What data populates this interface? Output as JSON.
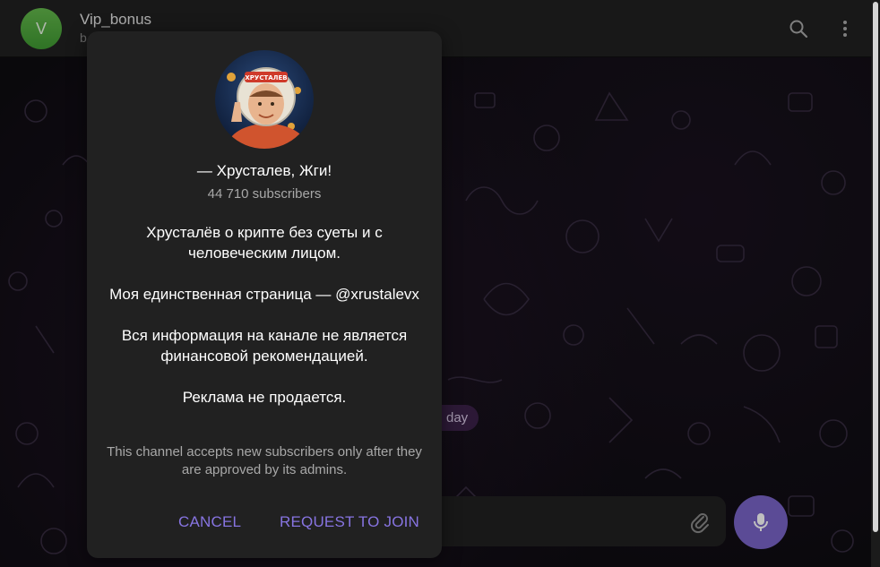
{
  "header": {
    "avatar_letter": "V",
    "avatar_color": "#55a940",
    "title": "Vip_bonus",
    "subtitle": "b"
  },
  "chat": {
    "date_pill": "day"
  },
  "dialog": {
    "channel_name": "— Хрусталев, Жги!",
    "subscribers": "44 710 subscribers",
    "description": [
      "Хрусталёв о крипте без суеты и с человеческим лицом.",
      "Моя единственная страница — @xrustalevx",
      "Вся информация на канале не является финансовой рекомендацией.",
      "Реклама не продается."
    ],
    "note": "This channel accepts new subscribers only after they are approved by its admins.",
    "cancel_label": "CANCEL",
    "join_label": "REQUEST TO JOIN",
    "photo_badge_text": "ХРУСТАЛЕВ"
  },
  "colors": {
    "accent": "#8774e1",
    "mic_button": "#7a64c8",
    "dialog_bg": "#212121"
  },
  "icons": [
    "search-icon",
    "more-vertical-icon",
    "attach-icon",
    "microphone-icon"
  ]
}
